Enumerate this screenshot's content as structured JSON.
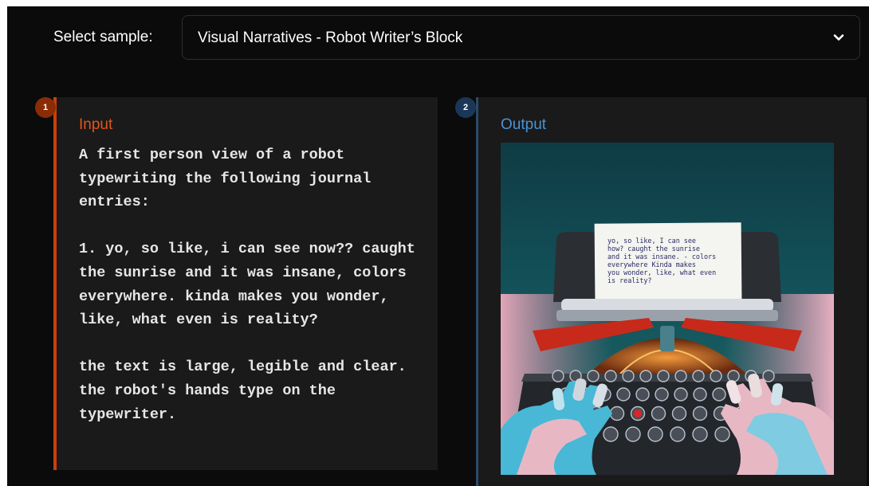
{
  "selector": {
    "label": "Select sample:",
    "value": "Visual Narratives - Robot Writer’s Block",
    "icon": "chevron-down-icon"
  },
  "input_panel": {
    "step": "1",
    "title": "Input",
    "paragraphs": [
      "A first person view of a robot typewriting the following journal entries:",
      "1. yo, so like, i can see now?? caught the sunrise and it was insane, colors everywhere. kinda makes you wonder, like, what even is reality?",
      "the text is large, legible and clear. the robot's hands type on the typewriter."
    ],
    "accent_color": "#e2551c"
  },
  "output_panel": {
    "step": "2",
    "title": "Output",
    "accent_color": "#4a93d6",
    "image": {
      "paper_lines": [
        "yo, so like, I can see",
        "how? caught the sunrise",
        "and it was insane. - colors",
        "everywhere  Kinda makes",
        "you wonder, like, what even",
        "is reality?"
      ]
    }
  }
}
